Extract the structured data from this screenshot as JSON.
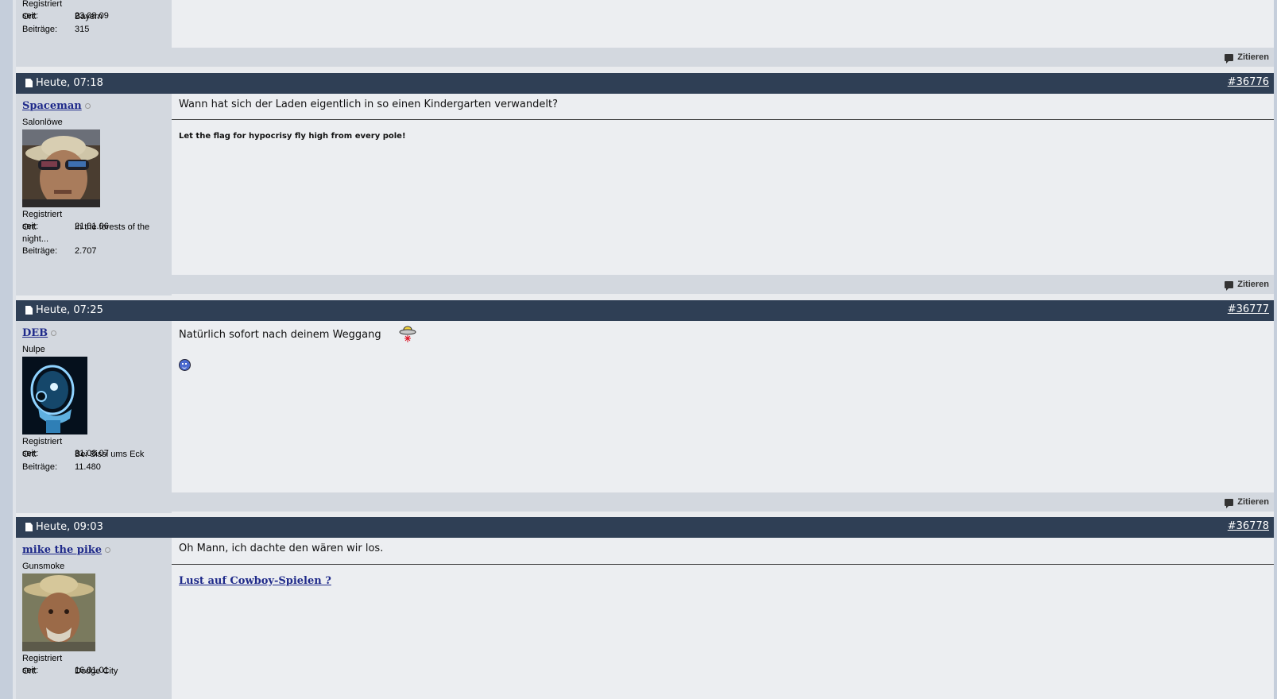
{
  "prev_post": {
    "info": [
      {
        "label": "Registriert seit:",
        "value": "23.08.09"
      },
      {
        "label": "Ort:",
        "value": "Bayern"
      },
      {
        "label": "Beiträge:",
        "value": "315"
      }
    ],
    "quote_label": "Zitieren"
  },
  "posts": [
    {
      "date": "Heute, 07:18",
      "number": "#36776",
      "username": "Spaceman",
      "usertitle": "Salonlöwe",
      "registered_label": "Registriert seit:",
      "registered": "21.01.06",
      "location_label": "Ort:",
      "location": "In the forests of the night...",
      "posts_label": "Beiträge:",
      "posts": "2.707",
      "message": "Wann hat sich der Laden eigentlich in so einen Kindergarten verwandelt?",
      "signature": "Let the flag for hypocrisy fly high from every pole!",
      "quote_label": "Zitieren"
    },
    {
      "date": "Heute, 07:25",
      "number": "#36777",
      "username": "DEB",
      "usertitle": "Nulpe",
      "registered_label": "Registriert seit:",
      "registered": "31.08.07",
      "location_label": "Ort:",
      "location": "Bei Sissi ums Eck",
      "posts_label": "Beiträge:",
      "posts": "11.480",
      "message": "Natürlich sofort nach deinem Weggang",
      "quote_label": "Zitieren"
    },
    {
      "date": "Heute, 09:03",
      "number": "#36778",
      "username": "mike the pike",
      "usertitle": "Gunsmoke",
      "registered_label": "Registriert seit:",
      "registered": "16.01.01",
      "location_label": "Ort:",
      "location": "Dodge City",
      "message": "Oh Mann, ich dachte den wären wir los.",
      "signature_link": "Lust auf Cowboy-Spielen ?"
    }
  ],
  "icons": {
    "post_icon": "document-icon",
    "quote_icon": "quote-icon",
    "status_icon": "offline-status-icon",
    "smiley": "smiley-icon",
    "ufo": "ufo-icon"
  },
  "colors": {
    "header_bg": "#2f3f55",
    "userinfo_bg": "#d3d8df",
    "content_bg": "#eceef1",
    "link": "#1f2a8a"
  }
}
